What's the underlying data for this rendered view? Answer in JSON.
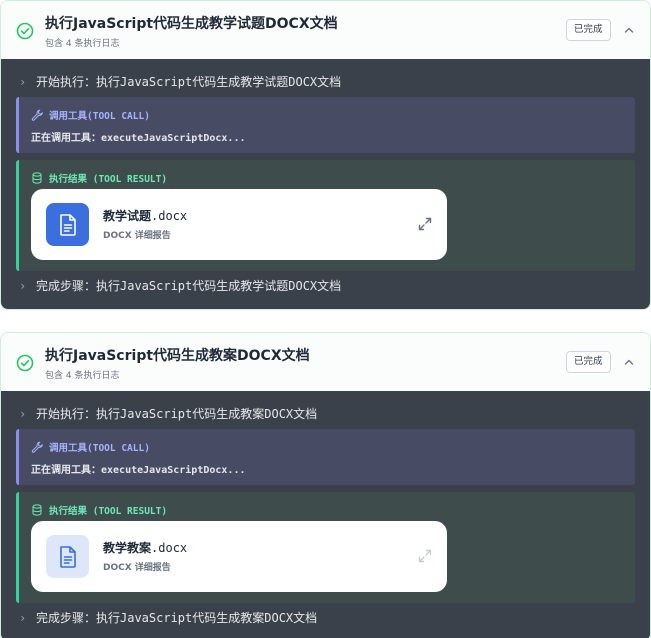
{
  "cards": [
    {
      "title": "执行JavaScript代码生成教学试题DOCX文档",
      "subtitle": "包含 4 条执行日志",
      "status": "已完成",
      "start_line": "开始执行：执行JavaScript代码生成教学试题DOCX文档",
      "tool_call_label": "调用工具(TOOL CALL)",
      "tool_call_text": "正在调用工具：executeJavaScriptDocx...",
      "tool_result_label": "执行结果 (TOOL RESULT)",
      "file_name": "教学试题",
      "file_ext": ".docx",
      "file_meta": "DOCX  详细报告",
      "end_line": "完成步骤：执行JavaScript代码生成教学试题DOCX文档"
    },
    {
      "title": "执行JavaScript代码生成教案DOCX文档",
      "subtitle": "包含 4 条执行日志",
      "status": "已完成",
      "start_line": "开始执行：执行JavaScript代码生成教案DOCX文档",
      "tool_call_label": "调用工具(TOOL CALL)",
      "tool_call_text": "正在调用工具：executeJavaScriptDocx...",
      "tool_result_label": "执行结果 (TOOL RESULT)",
      "file_name": "教学教案",
      "file_ext": ".docx",
      "file_meta": "DOCX  详细报告",
      "end_line": "完成步骤：执行JavaScript代码生成教案DOCX文档"
    }
  ],
  "colors": {
    "accent_green": "#34d399",
    "accent_indigo": "#8b8ff0",
    "file_icon_primary": "#3b6fe0",
    "body_dark": "#3b414b"
  },
  "icons": [
    "check-circle-icon",
    "chevron-up-icon",
    "chevron-right-icon",
    "wrench-icon",
    "database-icon",
    "document-icon",
    "expand-icon"
  ]
}
